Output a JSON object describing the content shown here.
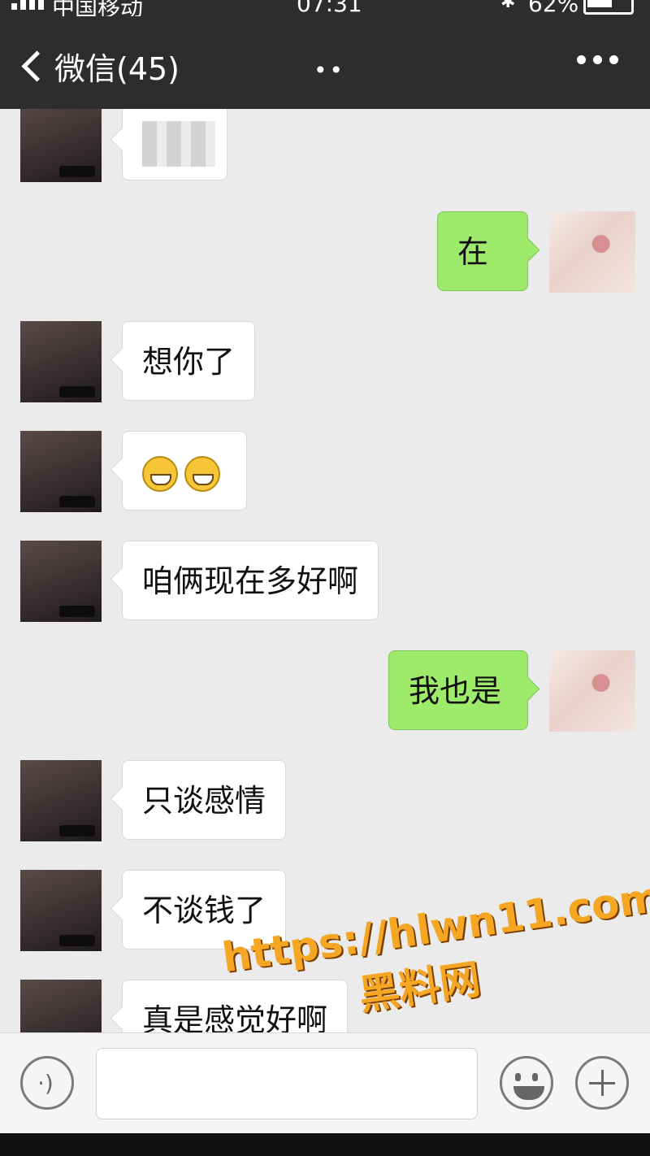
{
  "status_bar": {
    "carrier": "中国移动",
    "time": "07:31",
    "battery": "62%"
  },
  "header": {
    "back_label": "微信(45)",
    "title_dots": "••"
  },
  "messages": [
    {
      "side": "in",
      "content": "[blurred]"
    },
    {
      "side": "out",
      "text": "在"
    },
    {
      "side": "in",
      "text": "想你了"
    },
    {
      "side": "in",
      "emoji": [
        "grin-emoji",
        "grin-emoji"
      ]
    },
    {
      "side": "in",
      "text": "咱俩现在多好啊"
    },
    {
      "side": "out",
      "text": "我也是"
    },
    {
      "side": "in",
      "text": "只谈感情"
    },
    {
      "side": "in",
      "text": "不谈钱了"
    },
    {
      "side": "in",
      "text": "真是感觉好啊"
    }
  ],
  "watermark": {
    "url": "https://hlwn11.com",
    "label": "黑料网"
  },
  "input_bar": {
    "value": ""
  },
  "colors": {
    "header_bg": "#2d2d2d",
    "chat_bg": "#ebebeb",
    "outgoing_bubble": "#9eea6a",
    "incoming_bubble": "#ffffff",
    "watermark": "#f5a623"
  }
}
